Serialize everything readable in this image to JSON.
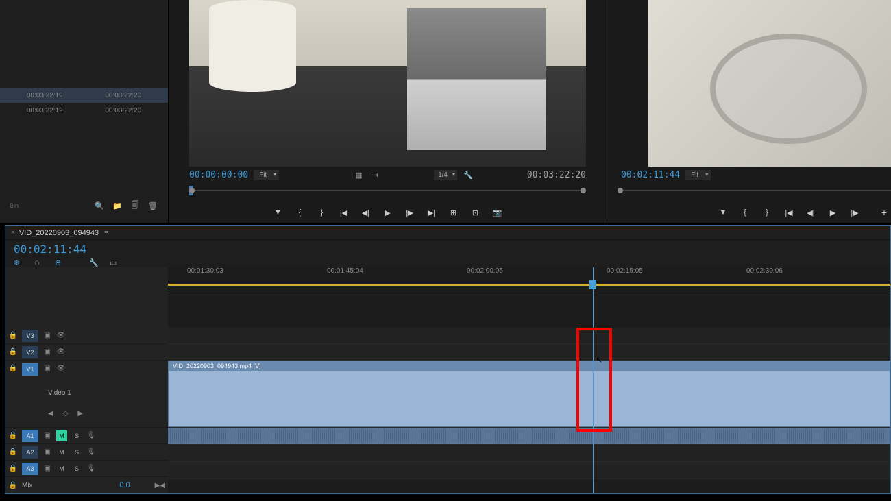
{
  "data_panel": {
    "rows": [
      {
        "in": "00:03:22:19",
        "out": "00:03:22:20",
        "selected": true
      },
      {
        "in": "00:03:22:19",
        "out": "00:03:22:20",
        "selected": false
      }
    ],
    "bin_label": "Bin"
  },
  "source_monitor": {
    "timecode_in": "00:00:00:00",
    "fit_label": "Fit",
    "resolution": "1/4",
    "timecode_out": "00:03:22:20"
  },
  "program_monitor": {
    "timecode_in": "00:02:11:44",
    "fit_label": "Fit"
  },
  "timeline": {
    "sequence_name": "VID_20220903_094943",
    "playhead_timecode": "00:02:11:44",
    "ruler_marks": [
      "00:01:30:03",
      "00:01:45:04",
      "00:02:00:05",
      "00:02:15:05",
      "00:02:30:06"
    ],
    "tracks": {
      "v3": {
        "label": "V3"
      },
      "v2": {
        "label": "V2"
      },
      "v1": {
        "label": "V1",
        "name": "Video 1"
      },
      "a1": {
        "label": "A1",
        "mute": "M",
        "solo": "S"
      },
      "a2": {
        "label": "A2",
        "mute": "M",
        "solo": "S"
      },
      "a3": {
        "label": "A3",
        "mute": "M",
        "solo": "S"
      },
      "mix": {
        "label": "Mix",
        "value": "0.0"
      }
    },
    "clip_name": "VID_20220903_094943.mp4 [V]"
  }
}
